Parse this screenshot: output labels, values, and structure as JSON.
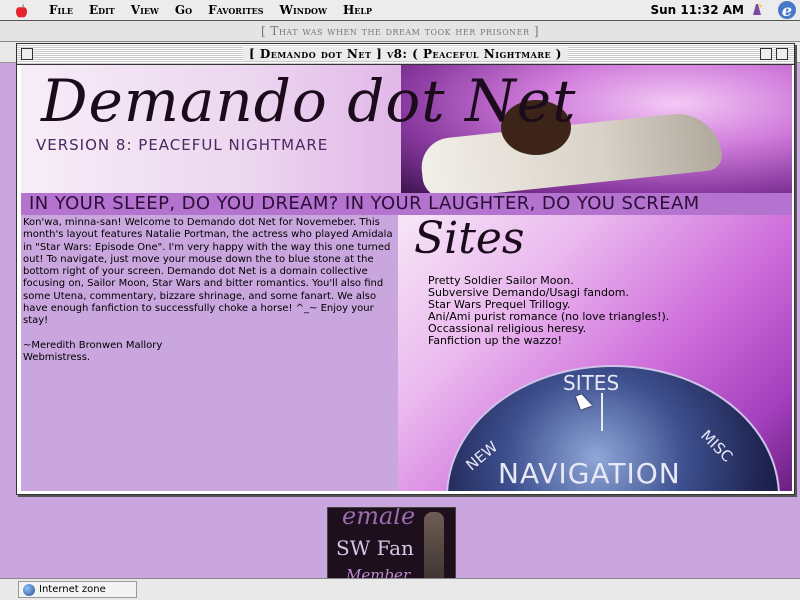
{
  "menubar": {
    "items": [
      "File",
      "Edit",
      "View",
      "Go",
      "Favorites",
      "Window",
      "Help"
    ],
    "clock": "Sun 11:32 AM",
    "apple_icon": "apple-icon",
    "browser_icon": "internet-explorer-icon"
  },
  "background_window": {
    "title": "[ That was when the dream took her prisoner ]"
  },
  "front_window": {
    "title": "[ Demando dot Net ] v8: ( Peaceful Nightmare )"
  },
  "header": {
    "site_title": "Demando dot Net",
    "version": "VERSION 8: PEACEFUL NIGHTMARE",
    "tagline": "IN YOUR SLEEP, DO YOU DREAM? IN YOUR LAUGHTER, DO YOU SCREAM"
  },
  "intro": {
    "paragraph": "Kon'wa, minna-san! Welcome to Demando dot Net for Novemeber. This month's layout features Natalie Portman, the actress who played Amidala in \"Star Wars: Episode One\". I'm very happy with the way this one turned out! To navigate, just move your mouse down the to blue stone at the bottom right of your screen. Demando dot Net is a domain collective focusing on, Sailor Moon, Star Wars and bitter romantics. You'll also find some Utena, commentary, bizzare shrinage, and some fanart. We also have enough fanfiction to successfully choke a horse! ^_~ Enjoy your stay!",
    "signature_name": "~Meredith Bronwen Mallory",
    "signature_role": "Webmistress."
  },
  "sites": {
    "heading": "Sites",
    "items": [
      "Pretty Soldier Sailor Moon.",
      "Subversive Demando/Usagi fandom.",
      "Star Wars Prequel Trillogy.",
      "Ani/Ami purist romance (no love triangles!).",
      "Occassional religious heresy.",
      "Fanfiction up the wazzo!"
    ]
  },
  "navigation": {
    "sites": "SITES",
    "new": "NEW",
    "misc": "MISC",
    "main": "NAVIGATION"
  },
  "fanlisting": {
    "line1": "emale",
    "line2": "SW Fan",
    "line3": "Member"
  },
  "status": {
    "zone": "Internet zone"
  }
}
